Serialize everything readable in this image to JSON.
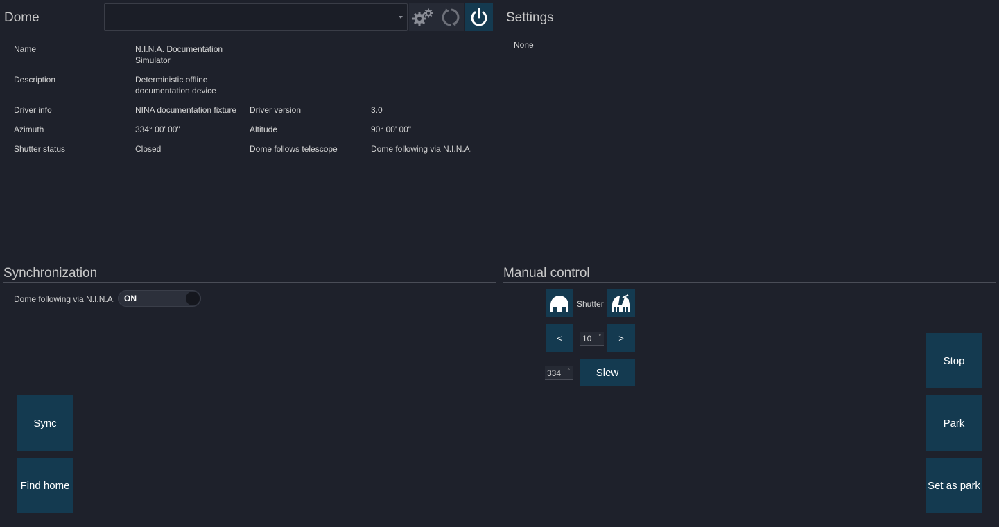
{
  "dome": {
    "title": "Dome",
    "device_selected": "",
    "fields": [
      {
        "label": "Name",
        "value": "N.I.N.A. Documentation\nSimulator"
      },
      {
        "label": "Description",
        "value": "Deterministic offline\ndocumentation device"
      },
      {
        "label": "Driver info",
        "value": "NINA documentation fixture"
      },
      {
        "label": "Azimuth",
        "value": "334° 00' 00\""
      },
      {
        "label": "Shutter status",
        "value": "Closed"
      }
    ],
    "fields_right": [
      {
        "label": "Driver version",
        "value": "3.0"
      },
      {
        "label": "Altitude",
        "value": "90° 00' 00\""
      },
      {
        "label": "Dome follows telescope",
        "value": "Dome following via N.I.N.A."
      }
    ]
  },
  "settings": {
    "title": "Settings",
    "value": "None"
  },
  "synchronization": {
    "title": "Synchronization",
    "following_label": "Dome following via N.I.N.A.",
    "toggle_text": "ON",
    "sync_label": "Sync",
    "find_home_label": "Find home"
  },
  "manual": {
    "title": "Manual control",
    "shutter_label": "Shutter",
    "step_value": "10",
    "step_unit": "°",
    "left_label": "<",
    "right_label": ">",
    "azimuth_value": "334",
    "azimuth_unit": "°",
    "slew_label": "Slew",
    "stop_label": "Stop",
    "park_label": "Park",
    "set_park_label": "Set as park"
  },
  "icons": {
    "settings": "gears-icon",
    "refresh": "refresh-icon",
    "power": "power-icon",
    "shutter_close": "dome-closed-icon",
    "shutter_open": "dome-open-icon"
  },
  "colors": {
    "background": "#1e212b",
    "button": "#143a50",
    "text": "#d8d8d8"
  }
}
